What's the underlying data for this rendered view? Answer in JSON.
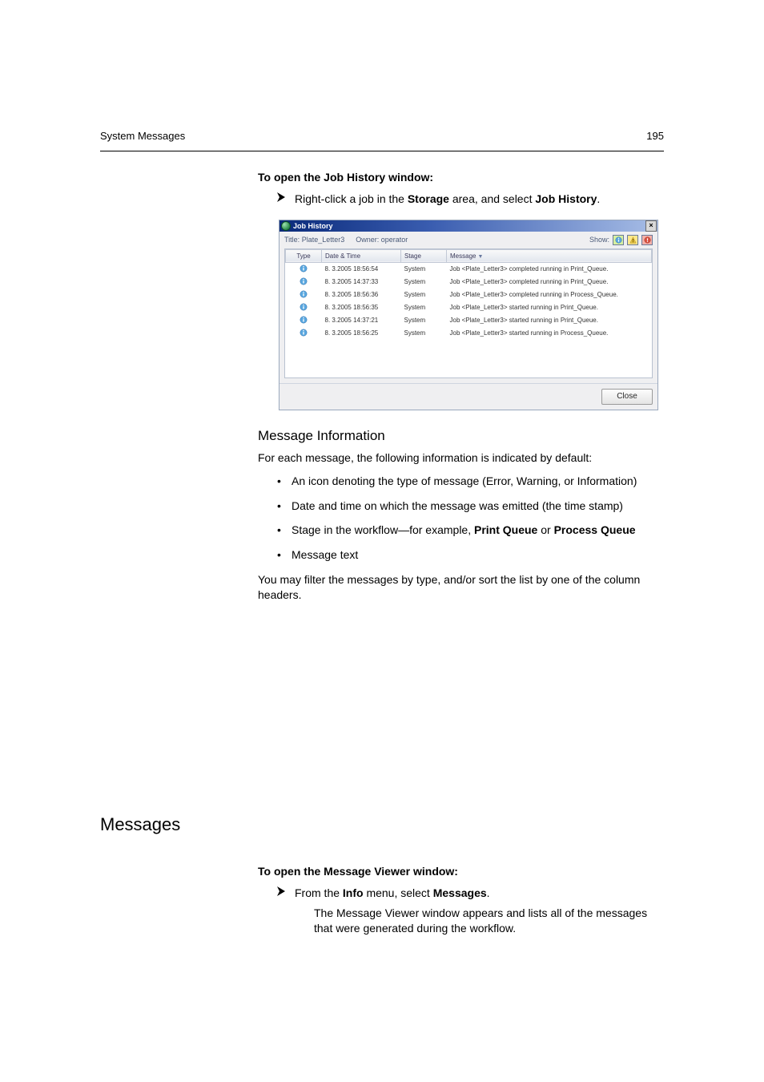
{
  "header": {
    "left": "System Messages",
    "right": "195"
  },
  "intro_heading": "To open the Job History window:",
  "step1_pre": "Right-click a job in the ",
  "step1_b1": "Storage",
  "step1_mid": " area, and select ",
  "step1_b2": "Job History",
  "step1_end": ".",
  "window": {
    "title": "Job History",
    "title_lbl": "Title:",
    "title_val": "Plate_Letter3",
    "owner_lbl": "Owner:",
    "owner_val": "operator",
    "show_label": "Show:",
    "close_btn": "Close",
    "cols": {
      "type": "Type",
      "dt": "Date & Time",
      "stage": "Stage",
      "msg": "Message"
    },
    "rows": [
      {
        "dt": "8. 3.2005 18:56:54",
        "stage": "System",
        "msg": "Job <Plate_Letter3> completed running in Print_Queue."
      },
      {
        "dt": "8. 3.2005 14:37:33",
        "stage": "System",
        "msg": "Job <Plate_Letter3> completed running in Print_Queue."
      },
      {
        "dt": "8. 3.2005 18:56:36",
        "stage": "System",
        "msg": "Job <Plate_Letter3> completed running in Process_Queue."
      },
      {
        "dt": "8. 3.2005 18:56:35",
        "stage": "System",
        "msg": "Job <Plate_Letter3> started running in Print_Queue."
      },
      {
        "dt": "8. 3.2005 14:37:21",
        "stage": "System",
        "msg": "Job <Plate_Letter3> started running in Print_Queue."
      },
      {
        "dt": "8. 3.2005 18:56:25",
        "stage": "System",
        "msg": "Job <Plate_Letter3> started running in Process_Queue."
      }
    ]
  },
  "sub_heading": "Message Information",
  "sub_intro": "For each message, the following information is indicated by default:",
  "bullets": {
    "b1": "An icon denoting the type of message (Error, Warning, or Information)",
    "b2": "Date and time on which the message was emitted (the time stamp)",
    "b3_pre": "Stage in the workflow—for example, ",
    "b3_b1": "Print Queue",
    "b3_mid": " or ",
    "b3_b2": "Process Queue",
    "b4": "Message text"
  },
  "filter_para": "You may filter the messages by type, and/or sort the list by one of the column headers.",
  "section2_title": "Messages",
  "sec2_heading": "To open the Message Viewer window:",
  "step2_pre": "From the ",
  "step2_b1": "Info",
  "step2_mid": " menu, select ",
  "step2_b2": "Messages",
  "step2_end": ".",
  "step2_sub": "The Message Viewer window appears and lists all of the messages that were generated during the workflow."
}
